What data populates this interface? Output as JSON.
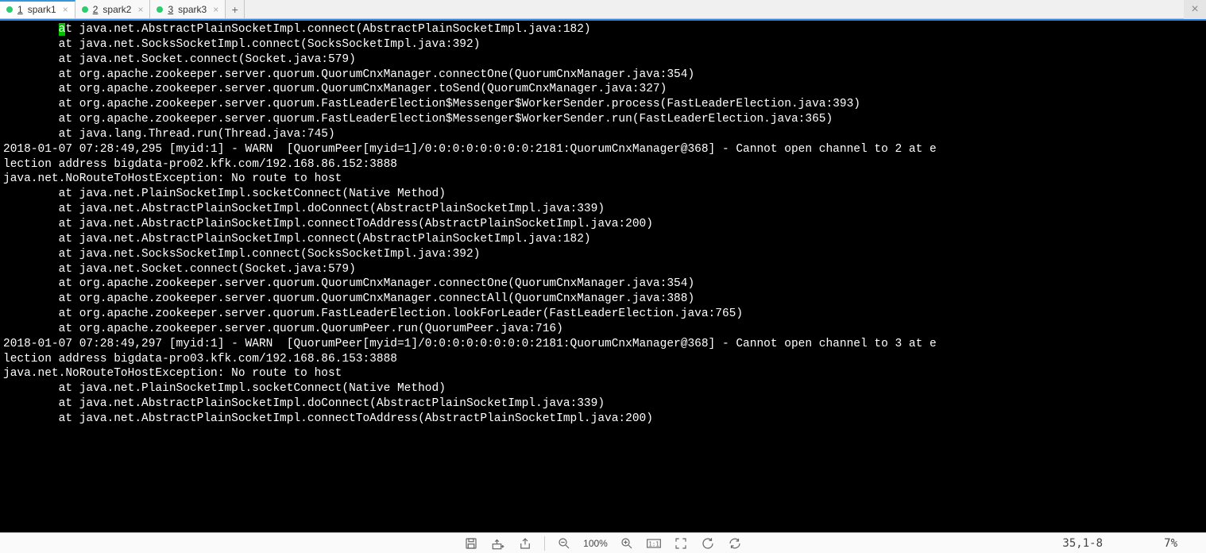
{
  "tabs": [
    {
      "num": "1",
      "label": "spark1",
      "active": true
    },
    {
      "num": "2",
      "label": "spark2",
      "active": false
    },
    {
      "num": "3",
      "label": "spark3",
      "active": false
    }
  ],
  "terminal": {
    "lines": [
      "        at java.net.AbstractPlainSocketImpl.connect(AbstractPlainSocketImpl.java:182)",
      "        at java.net.SocksSocketImpl.connect(SocksSocketImpl.java:392)",
      "        at java.net.Socket.connect(Socket.java:579)",
      "        at org.apache.zookeeper.server.quorum.QuorumCnxManager.connectOne(QuorumCnxManager.java:354)",
      "        at org.apache.zookeeper.server.quorum.QuorumCnxManager.toSend(QuorumCnxManager.java:327)",
      "        at org.apache.zookeeper.server.quorum.FastLeaderElection$Messenger$WorkerSender.process(FastLeaderElection.java:393)",
      "        at org.apache.zookeeper.server.quorum.FastLeaderElection$Messenger$WorkerSender.run(FastLeaderElection.java:365)",
      "        at java.lang.Thread.run(Thread.java:745)",
      "2018-01-07 07:28:49,295 [myid:1] - WARN  [QuorumPeer[myid=1]/0:0:0:0:0:0:0:0:2181:QuorumCnxManager@368] - Cannot open channel to 2 at e",
      "lection address bigdata-pro02.kfk.com/192.168.86.152:3888",
      "java.net.NoRouteToHostException: No route to host",
      "        at java.net.PlainSocketImpl.socketConnect(Native Method)",
      "        at java.net.AbstractPlainSocketImpl.doConnect(AbstractPlainSocketImpl.java:339)",
      "        at java.net.AbstractPlainSocketImpl.connectToAddress(AbstractPlainSocketImpl.java:200)",
      "        at java.net.AbstractPlainSocketImpl.connect(AbstractPlainSocketImpl.java:182)",
      "        at java.net.SocksSocketImpl.connect(SocksSocketImpl.java:392)",
      "        at java.net.Socket.connect(Socket.java:579)",
      "        at org.apache.zookeeper.server.quorum.QuorumCnxManager.connectOne(QuorumCnxManager.java:354)",
      "        at org.apache.zookeeper.server.quorum.QuorumCnxManager.connectAll(QuorumCnxManager.java:388)",
      "        at org.apache.zookeeper.server.quorum.FastLeaderElection.lookForLeader(FastLeaderElection.java:765)",
      "        at org.apache.zookeeper.server.quorum.QuorumPeer.run(QuorumPeer.java:716)",
      "2018-01-07 07:28:49,297 [myid:1] - WARN  [QuorumPeer[myid=1]/0:0:0:0:0:0:0:0:2181:QuorumCnxManager@368] - Cannot open channel to 3 at e",
      "lection address bigdata-pro03.kfk.com/192.168.86.153:3888",
      "java.net.NoRouteToHostException: No route to host",
      "        at java.net.PlainSocketImpl.socketConnect(Native Method)",
      "        at java.net.AbstractPlainSocketImpl.doConnect(AbstractPlainSocketImpl.java:339)",
      "        at java.net.AbstractPlainSocketImpl.connectToAddress(AbstractPlainSocketImpl.java:200)"
    ]
  },
  "status": {
    "zoom": "100%",
    "position": "35,1-8",
    "scroll": "7%"
  }
}
